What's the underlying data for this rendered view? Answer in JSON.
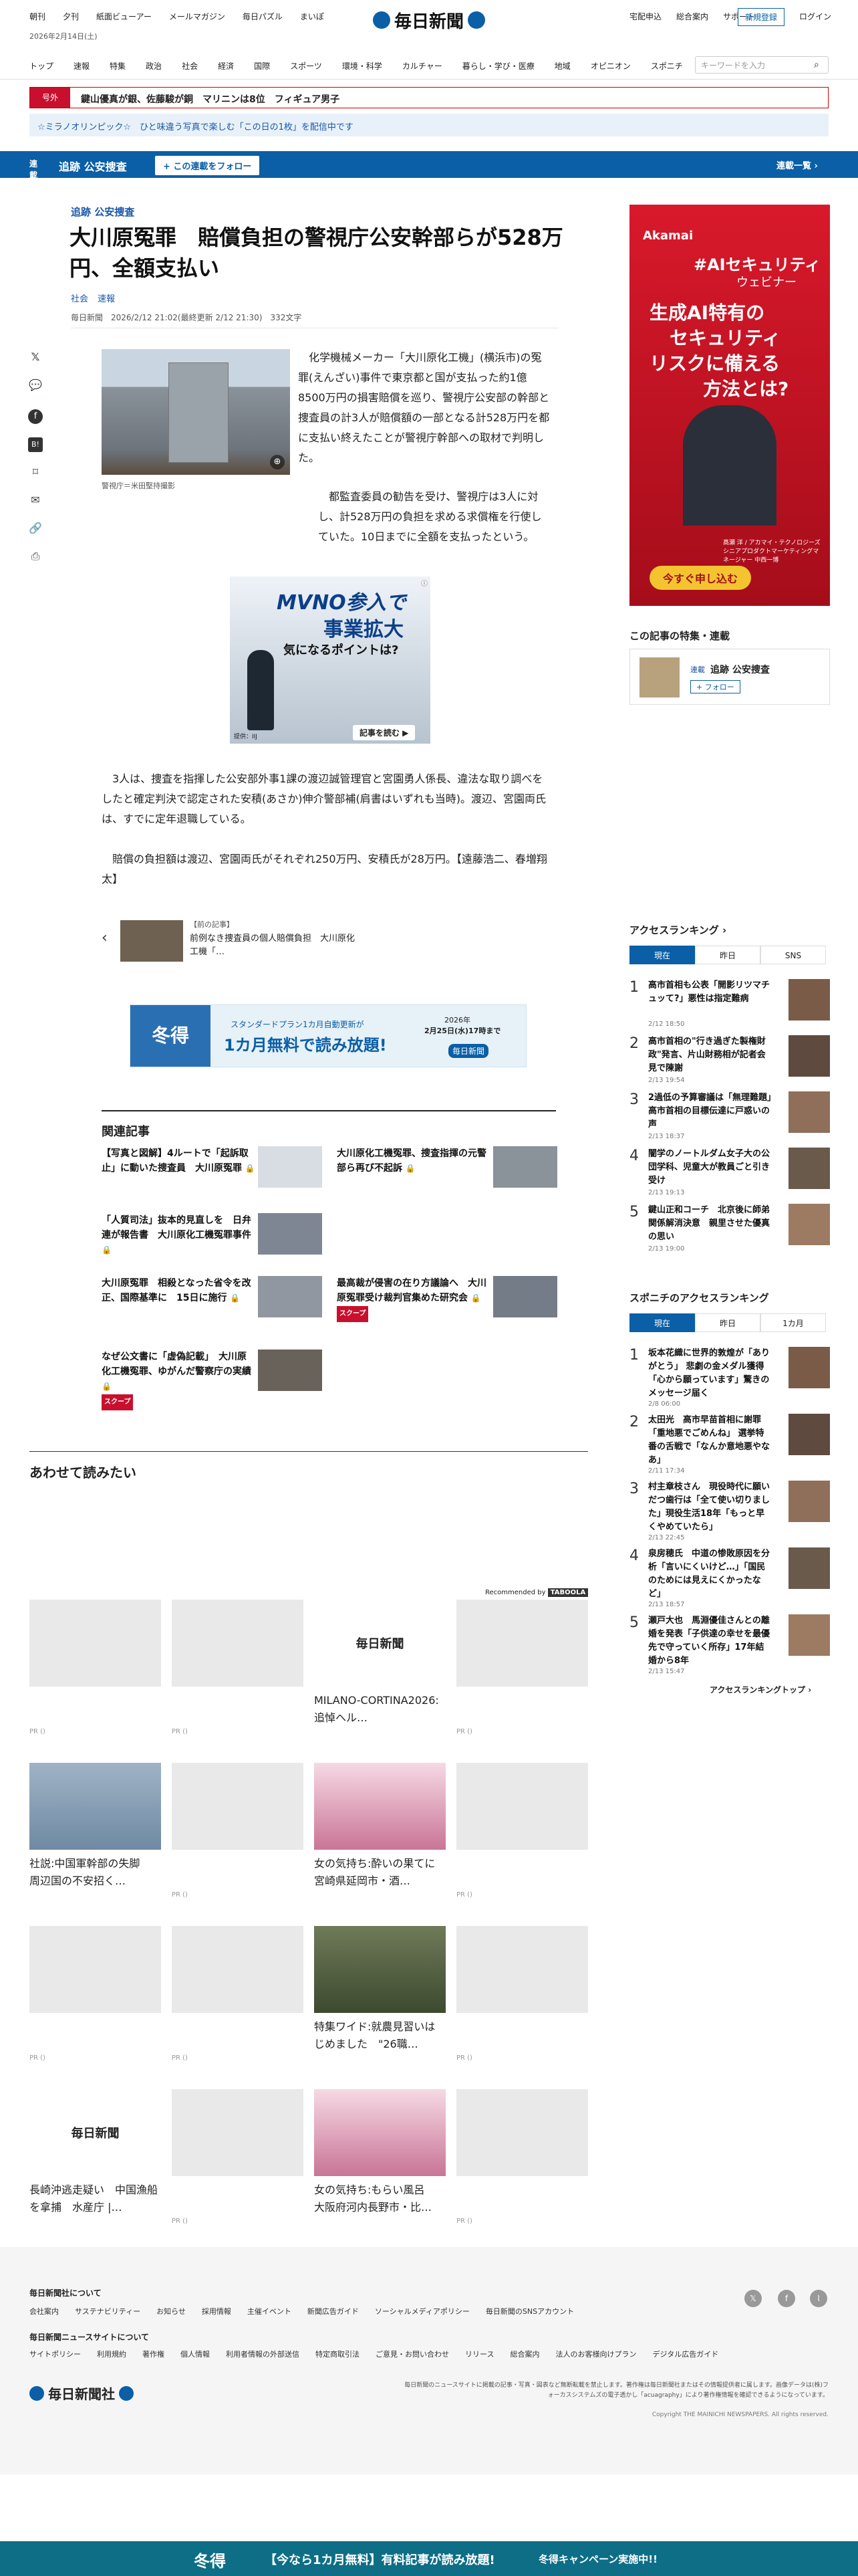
{
  "header": {
    "util_left": [
      "朝刊",
      "夕刊",
      "紙面ビューアー",
      "メールマガジン",
      "毎日パズル",
      "まいぽ"
    ],
    "logo": "毎日新聞",
    "util_right": [
      "宅配申込",
      "総合案内",
      "サポート"
    ],
    "register": "新規登録",
    "login": "ログイン",
    "date": "2026年2月14日(土)",
    "nav": [
      "トップ",
      "速報",
      "特集",
      "政治",
      "社会",
      "経済",
      "国際",
      "スポーツ",
      "環境・科学",
      "カルチャー",
      "暮らし・学び・医療",
      "地域",
      "オピニオン",
      "スポニチ"
    ],
    "search_placeholder": "キーワードを入力"
  },
  "breaking": {
    "label": "号外",
    "text": "鍵山優真が銀、佐藤駿が銅　マリニンは8位　フィギュア男子"
  },
  "promo": "☆ミラノオリンピック☆　ひと味違う写真で楽しむ「この日の1枚」を配信中です",
  "series": {
    "title": "追跡 公安捜査",
    "follow": "+ この連載をフォロー",
    "list": "連載一覧 ›"
  },
  "article": {
    "kicker": "追跡 公安捜査",
    "title": "大川原冤罪　賠償負担の警視庁公安幹部らが528万円、全額支払い",
    "tags": [
      "社会",
      "速報"
    ],
    "meta": "毎日新聞　2026/2/12 21:02(最終更新 2/12 21:30)　332文字",
    "photo_caption": "警視庁＝米田堅持撮影",
    "p1": "化学機械メーカー「大川原化工機」(横浜市)の冤罪(えんざい)事件で東京都と国が支払った約1億8500万円の損害賠償を巡り、警視庁公安部の幹部と捜査員の計3人が賠償額の一部となる計528万円を都に支払い終えたことが警視庁幹部への取材で判明した。",
    "p2": "都監査委員の勧告を受け、警視庁は3人に対し、計528万円の負担を求める求償権を行使していた。10日までに全額を支払ったという。",
    "p3": "3人は、捜査を指揮した公安部外事1課の渡辺誠管理官と宮園勇人係長、違法な取り調べをしたと確定判決で認定された安積(あさか)伸介警部補(肩書はいずれも当時)。渡辺、宮園両氏は、すでに定年退職している。",
    "p4": "賠償の負担額は渡辺、宮園両氏がそれぞれ250万円、安積氏が28万円。【遠藤浩二、春増翔太】",
    "ad_mvno_line1": "MVNO参入で",
    "ad_mvno_line2": "事業拡大",
    "ad_mvno_line3": "気になるポイントは?",
    "ad_mvno_sponsor": "提供：IIJ",
    "ad_mvno_cta": "記事を読む ▶",
    "prev_label": "【前の記事】",
    "prev_title": "前例なき捜査員の個人賠償負担　大川原化工機「…",
    "banner_left": "冬得",
    "banner_mid1": "スタンダードプラン1カ月自動更新が",
    "banner_mid2": "1カ月無料で読み放題!",
    "banner_right1": "2026年",
    "banner_right2": "2月25日(水)17時まで",
    "banner_logo": "毎日新聞"
  },
  "related": {
    "heading": "関連記事",
    "items": [
      {
        "text": "【写真と図解】4ルートで「起訴取止」に動いた捜査員　大川原冤罪",
        "lock": true,
        "scoop": false
      },
      {
        "text": "大川原化工機冤罪、捜査指揮の元警部ら再び不起訴",
        "lock": true,
        "scoop": false
      },
      {
        "text": "「人質司法」抜本的見直しを　日弁連が報告書　大川原化工機冤罪事件",
        "lock": true,
        "scoop": false
      },
      {
        "text": "",
        "lock": false,
        "scoop": false
      },
      {
        "text": "大川原冤罪　相殺となった省令を改正、国際基準に　15日に施行",
        "lock": true,
        "scoop": false
      },
      {
        "text": "最高裁が侵害の在り方議論へ　大川原冤罪受け裁判官集めた研究会",
        "lock": true,
        "scoop": true
      },
      {
        "text": "なぜ公文書に「虚偽記載」　大川原化工機冤罪、ゆがんだ警察庁の実績",
        "lock": true,
        "scoop": true
      }
    ],
    "scoop_label": "スクープ"
  },
  "sidebar": {
    "ad_brand": "Akamai",
    "ad_tag": "#AIセキュリティ",
    "ad_sub": "ウェビナー",
    "ad_l1": "生成AI特有の",
    "ad_l2": "セキュリティ",
    "ad_l3": "リスクに備える",
    "ad_l4": "方法とは?",
    "ad_person": "髙瀬 洋 / アカマイ・テクノロジーズ シニアプロダクトマーケティングマネージャー 中西一博",
    "ad_cta": "今すぐ申し込む",
    "feature_heading": "この記事の特集・連載",
    "feature_tag": "連載",
    "feature_title": "追跡 公安捜査",
    "feature_follow": "+ フォロー",
    "ranking_heading": "アクセスランキング ›",
    "ranking_tabs": [
      "現在",
      "昨日",
      "SNS"
    ],
    "ranking": [
      {
        "n": "1",
        "text": "高市首相も公表「開影リツマチュッて?」悪性は指定難病",
        "date": "2/12 18:50"
      },
      {
        "n": "2",
        "text": "高市首相の\"行き過ぎた製権財政\"発言、片山財務相が記者会見で陳謝",
        "date": "2/13 19:54"
      },
      {
        "n": "3",
        "text": "2過低の予算審議は「無理難題」高市首相の目標伝達に戸惑いの声",
        "date": "2/13 18:37"
      },
      {
        "n": "4",
        "text": "闇学のノートルダム女子大の公団学科、児童大が教員ごと引き受け",
        "date": "2/13 19:13"
      },
      {
        "n": "5",
        "text": "鍵山正和コーチ　北京後に師弟関係解消決意　親里させた優真の思い",
        "date": "2/13 19:00"
      }
    ],
    "sponichi_heading": "スポニチのアクセスランキング",
    "sponichi_tabs": [
      "現在",
      "昨日",
      "1カ月"
    ],
    "sponichi": [
      {
        "n": "1",
        "text": "坂本花織に世界的敦煌が「ありがとう」 悲劇の金メダル獲得「心から願っています」驚きのメッセージ届く",
        "date": "2/8 06:00"
      },
      {
        "n": "2",
        "text": "太田光　高市早苗首相に謝罪「重地悪でごめんね」 選挙特番の舌戦で「なんか意地悪やなあ」",
        "date": "2/11 17:34"
      },
      {
        "n": "3",
        "text": "村主章枝さん　現役時代に願いだつ歯行は「全て使い切りました」現役生活18年「もっと早くやめていたら」",
        "date": "2/13 22:45"
      },
      {
        "n": "4",
        "text": "泉房穂氏　中道の惨敗原因を分析「言いにくいけど…」「国民のためには見えにくかったなど」",
        "date": "2/13 18:57"
      },
      {
        "n": "5",
        "text": "瀬戸大也　馬淵優佳さんとの離婚を発表「子供達の幸せを最優先で守っていく所存」17年結婚から8年",
        "date": "2/13 15:47"
      }
    ],
    "ranking_top": "アクセスランキングトップ ›"
  },
  "recommend": {
    "heading": "あわせて読みたい",
    "by": "Recommended by",
    "cells": [
      {
        "cap": "",
        "pr": "PR ()"
      },
      {
        "cap": "",
        "pr": "PR ()"
      },
      {
        "cap": "MILANO-CORTINA2026:追悼ヘル…",
        "pr": ""
      },
      {
        "cap": "",
        "pr": "PR ()"
      },
      {
        "cap": "社説:中国軍幹部の失脚　周辺国の不安招く…",
        "pr": ""
      },
      {
        "cap": "",
        "pr": "PR ()"
      },
      {
        "cap": "女の気持ち:酔いの果てに　宮崎県延岡市・酒…",
        "pr": ""
      },
      {
        "cap": "",
        "pr": "PR ()"
      },
      {
        "cap": "",
        "pr": "PR ()"
      },
      {
        "cap": "",
        "pr": "PR ()"
      },
      {
        "cap": "特集ワイド:就農見習いはじめました　\"26職…",
        "pr": ""
      },
      {
        "cap": "",
        "pr": "PR ()"
      },
      {
        "cap": "長崎沖逃走疑い　中国漁船を拿捕　水産庁 |…",
        "pr": ""
      },
      {
        "cap": "",
        "pr": "PR ()"
      },
      {
        "cap": "女の気持ち:もらい風呂　大阪府河内長野市・比…",
        "pr": ""
      },
      {
        "cap": "",
        "pr": "PR ()"
      }
    ],
    "logo_text": "毎日新聞"
  },
  "footer": {
    "about": "毎日新聞社について",
    "links1": [
      "会社案内",
      "サステナビリティー",
      "お知らせ",
      "採用情報",
      "主催イベント",
      "新聞広告ガイド",
      "ソーシャルメディアポリシー",
      "毎日新聞のSNSアカウント"
    ],
    "site": "毎日新聞ニュースサイトについて",
    "links2": [
      "サイトポリシー",
      "利用規約",
      "著作権",
      "個人情報",
      "利用者情報の外部送信",
      "特定商取引法",
      "ご意見・お問い合わせ",
      "リリース",
      "総合案内",
      "法人のお客様向けプラン",
      "デジタル広告ガイド"
    ],
    "company": "毎日新聞社",
    "notice": "毎日新聞のニュースサイトに掲載の記事・写真・図表など無断転載を禁止します。著作権は毎日新聞社またはその情報提供者に属します。画像データは(株)フォーカスシステムズの電子透かし「acuagraphy」により著作権情報を確認できるようになっています。",
    "copyright": "Copyright THE MAINICHI NEWSPAPERS. All rights reserved."
  },
  "bottom_bar": {
    "left": "冬得",
    "text": "【今なら1カ月無料】有料記事が読み放題!",
    "right": "冬得キャンペーン実施中!!"
  },
  "colors": {
    "brand": "#0a5fa6",
    "red": "#c8102e",
    "link": "#1a56a8"
  }
}
